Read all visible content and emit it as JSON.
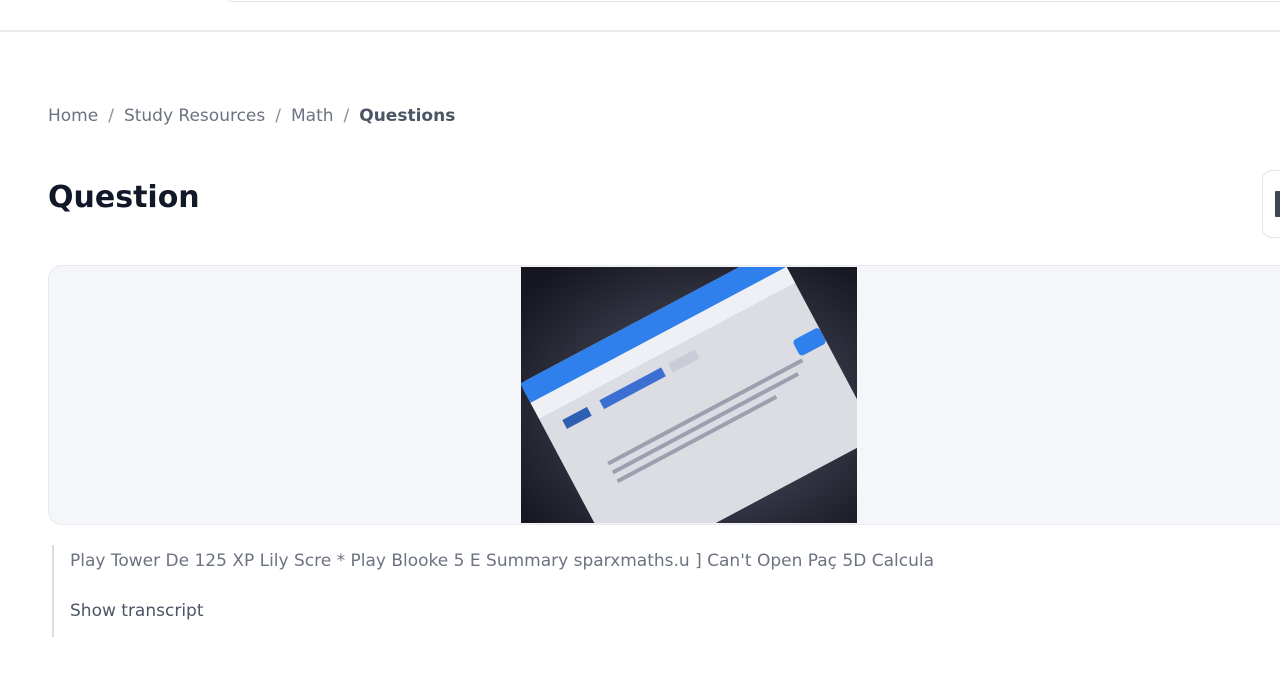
{
  "breadcrumb": {
    "home": "Home",
    "study_resources": "Study Resources",
    "math": "Math",
    "current": "Questions",
    "separator": "/"
  },
  "page": {
    "title": "Question"
  },
  "question": {
    "image_icon": "question-photo",
    "transcript_text": "Play Tower De 125 XP Lily Scre * Play Blooke 5 E Summary sparxmaths.u ] Can't Open Paç 5D Calcula",
    "show_transcript_label": "Show transcript"
  },
  "colors": {
    "page_background": "#ffffff",
    "card_background": "#f5f6f9",
    "text_muted": "#6b7280",
    "text_strong": "#111827",
    "photo_accent": "#2f80ed"
  }
}
